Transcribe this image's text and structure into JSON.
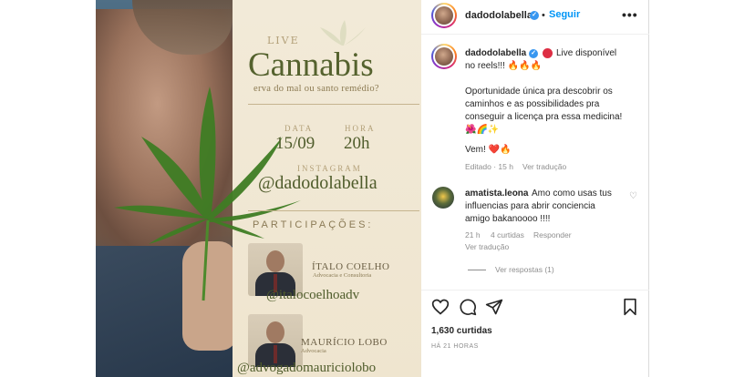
{
  "poster": {
    "live": "LIVE",
    "title": "Cannabis",
    "subtitle": "erva do mal ou santo remédio?",
    "date_label": "DATA",
    "date": "15/09",
    "time_label": "HORA",
    "time": "20h",
    "instagram_label": "INSTAGRAM",
    "handle": "@dadodolabella",
    "participations": "PARTICIPAÇÕES:",
    "guests": [
      {
        "name": "ÍTALO COELHO",
        "role": "Advocacia e Consultoria",
        "handle": "@italocoelhoadv"
      },
      {
        "name": "MAURÍCIO LOBO",
        "role": "Advocacia",
        "handle": "@advogadomauriciolobo"
      }
    ]
  },
  "header": {
    "username": "dadodolabella",
    "separator": "•",
    "follow": "Seguir",
    "more": "•••"
  },
  "caption": {
    "username": "dadodolabella",
    "line1": "Live disponível",
    "line2": "no reels!!! 🔥🔥🔥",
    "line3": "Oportunidade única pra descobrir os",
    "line4": "caminhos e as possibilidades pra",
    "line5": "conseguir a licença pra essa medicina!",
    "line6": "🌺🌈✨",
    "line7": "Vem! ❤️🔥",
    "edited": "Editado · 15 h",
    "translate": "Ver tradução"
  },
  "comment": {
    "username": "amatista.leona",
    "text1": "Amo como usas tus",
    "text2": "influencias para abrir conciencia",
    "text3": "amigo bakanoooo !!!!",
    "age": "21 h",
    "likes": "4 curtidas",
    "reply": "Responder",
    "translate": "Ver tradução",
    "view_replies": "Ver respostas (1)"
  },
  "actions": {
    "icons": [
      "heart-icon",
      "comment-icon",
      "share-icon",
      "bookmark-icon"
    ]
  },
  "post": {
    "likes": "1,630 curtidas",
    "time": "HÁ 21 HORAS"
  },
  "colors": {
    "link": "#0095f6",
    "text": "#262626",
    "muted": "#8e8e8e",
    "poster_green": "#55622e"
  }
}
